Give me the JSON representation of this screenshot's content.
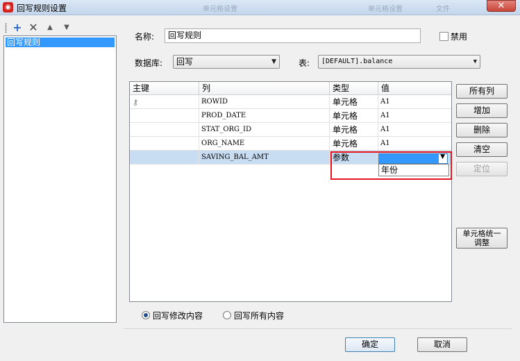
{
  "window": {
    "title": "回写规则设置",
    "ghost_tabs": [
      "单元格设置",
      "单元格设置",
      "文件"
    ],
    "close_glyph": "✕"
  },
  "left_panel": {
    "toolbar": {
      "add_icon": "plus-icon",
      "delete_icon": "x-icon",
      "up_icon": "triangle-up-icon",
      "down_icon": "triangle-down-icon"
    },
    "items": [
      "回写规则"
    ]
  },
  "form": {
    "name_label": "名称:",
    "name_value": "回写规则",
    "disable_label": "禁用",
    "disable_checked": false,
    "database_label": "数据库:",
    "database_value": "回写",
    "table_label": "表:",
    "table_value": "[DEFAULT].balance"
  },
  "grid": {
    "columns": [
      "主键",
      "列",
      "类型",
      "值"
    ],
    "rows": [
      {
        "key": true,
        "column": "ROWID",
        "type": "单元格",
        "value": "A1"
      },
      {
        "key": false,
        "column": "PROD_DATE",
        "type": "单元格",
        "value": "A1"
      },
      {
        "key": false,
        "column": "STAT_ORG_ID",
        "type": "单元格",
        "value": "A1"
      },
      {
        "key": false,
        "column": "ORG_NAME",
        "type": "单元格",
        "value": "A1"
      },
      {
        "key": false,
        "column": "SAVING_BAL_AMT",
        "type": "参数",
        "value": ""
      }
    ],
    "dropdown_option": "年份"
  },
  "right_buttons": {
    "all_columns": "所有列",
    "add": "增加",
    "delete": "删除",
    "clear": "清空",
    "locate": "定位",
    "unify_line1": "单元格统一",
    "unify_line2": "调整"
  },
  "options": {
    "modify_label": "回写修改内容",
    "all_label": "回写所有内容",
    "selected": "modify"
  },
  "footer": {
    "ok": "确定",
    "cancel": "取消"
  },
  "colors": {
    "selection": "#3399ff",
    "highlight_box": "#e5141d",
    "selected_row": "#c8dcf2"
  }
}
